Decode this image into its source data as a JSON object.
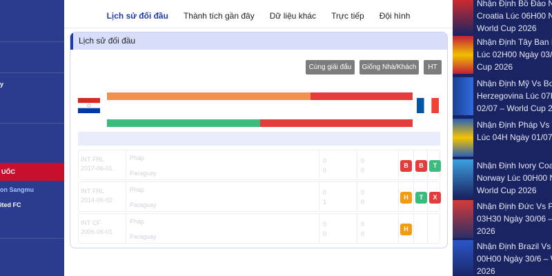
{
  "left_sidebar": {
    "text_y": "y",
    "section_label": "UỐC",
    "player": "on Sangmu",
    "club": "ited FC"
  },
  "right_sidebar": {
    "news": [
      {
        "text": "Nhận Định Bồ Đào N\nCroatia Lúc 06H00 N\nWorld Cup 2026"
      },
      {
        "text": "Nhận Định Tây Ban N\nLúc 02H00 Ngày 03/\nCup 2026"
      },
      {
        "text": "Nhận Định Mỹ Vs Bos\nHerzegovina Lúc 07H\n02/07 – World Cup 20"
      },
      {
        "text": "Nhận Định Pháp Vs T\nLúc 04H Ngày 01/07"
      },
      {
        "text": "Nhận Định Ivory Coa\nNorway Lúc 00H00 N\nWorld Cup 2026"
      },
      {
        "text": "Nhận Định Đức Vs Po\n03H30 Ngày 30/06 –\n2026"
      },
      {
        "text": "Nhận Định Brazil Vs J\n00H00 Ngày 30/6 – W\n2026"
      }
    ]
  },
  "tabs": [
    {
      "label": "Lịch sử đối đầu",
      "active": true
    },
    {
      "label": "Thành tích gần đây",
      "active": false
    },
    {
      "label": "Dữ liệu khác",
      "active": false
    },
    {
      "label": "Trực tiếp",
      "active": false
    },
    {
      "label": "Đội hình",
      "active": false
    }
  ],
  "panel": {
    "title": "Lịch sử đối đầu",
    "filters": [
      "Cùng giải đấu",
      "Giống Nhà/Khách",
      "HT"
    ]
  },
  "comparison_bars": {
    "top": {
      "home_fraction": 0.667,
      "home_color": "#f0914f",
      "away_color": "#e63b3b"
    },
    "bottom": {
      "home_fraction": 0.5,
      "home_color": "#3dbb7e",
      "away_color": "#e63b3b"
    }
  },
  "matches": [
    {
      "league": "INT FRL",
      "date": "2017-06-01",
      "home": "Pháp",
      "away": "Paraguay",
      "score_ft_home": "0",
      "score_ft_away": "0",
      "score_ht_home": "0",
      "score_ht_away": "0",
      "badges": [
        "B",
        "B",
        "T"
      ]
    },
    {
      "league": "INT FRL",
      "date": "2014-06-02",
      "home": "Pháp",
      "away": "Paraguay",
      "score_ft_home": "0",
      "score_ft_away": "1",
      "score_ht_home": "0",
      "score_ht_away": "0",
      "badges": [
        "H",
        "T",
        "X"
      ]
    },
    {
      "league": "INT CF",
      "date": "2006-06-01",
      "home": "Pháp",
      "away": "Paraguay",
      "score_ft_home": "0",
      "score_ft_away": "0",
      "score_ht_home": "0",
      "score_ht_away": "0",
      "badges": [
        "H"
      ]
    }
  ],
  "colors": {
    "accent": "#1f3aa8",
    "header_bg": "#d8defa",
    "button_gray": "#7c7c7c",
    "badge_red": "#e63b3b",
    "badge_green": "#3dbb7e",
    "badge_orange": "#f39c12"
  },
  "icons": {
    "home_flag": "paraguay-flag-icon",
    "away_flag": "france-flag-icon"
  }
}
